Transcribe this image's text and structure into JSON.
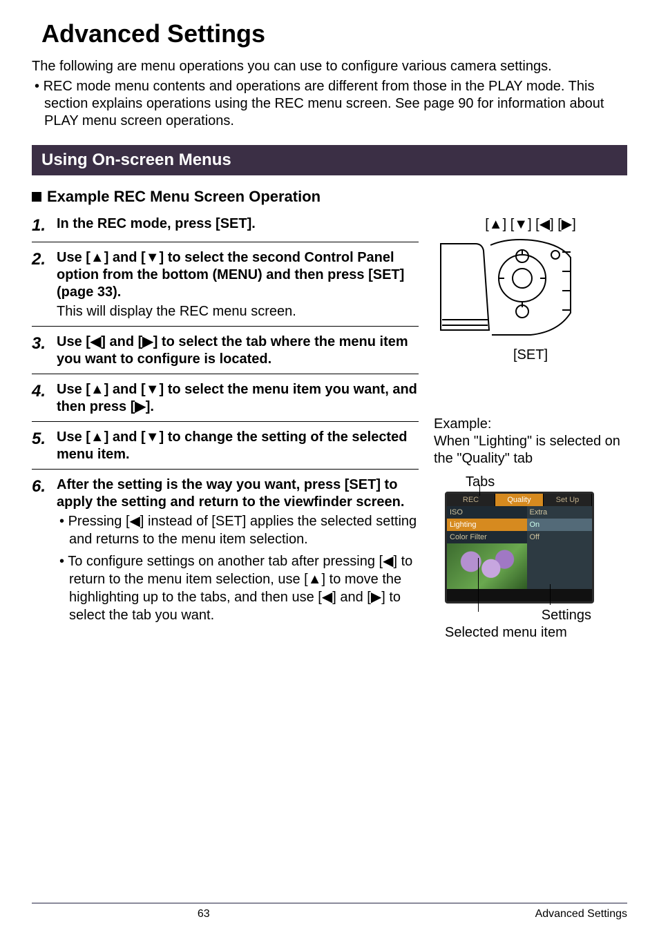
{
  "glyphs": {
    "up": "▲",
    "down": "▼",
    "left": "◀",
    "right": "▶",
    "bullet": "•"
  },
  "title": "Advanced Settings",
  "intro": "The following are menu operations you can use to configure various camera settings.",
  "note": "REC mode menu contents and operations are different from those in the PLAY mode. This section explains operations using the REC menu screen. See page 90 for information about PLAY menu screen operations.",
  "section": "Using On-screen Menus",
  "subhead": "Example REC Menu Screen Operation",
  "steps": {
    "s1": {
      "num": "1.",
      "bold": "In the REC mode, press [SET]."
    },
    "s2": {
      "num": "2.",
      "bold_a": "Use [",
      "bold_b": "] and [",
      "bold_c": "] to select the second Control Panel option from the bottom (MENU) and then press [SET] (page 33).",
      "body": "This will display the REC menu screen."
    },
    "s3": {
      "num": "3.",
      "bold_a": "Use [",
      "bold_b": "] and [",
      "bold_c": "] to select the tab where the menu item you want to configure is located."
    },
    "s4": {
      "num": "4.",
      "bold_a": "Use [",
      "bold_b": "] and [",
      "bold_c": "] to select the menu item you want, and then press [",
      "bold_d": "]."
    },
    "s5": {
      "num": "5.",
      "bold_a": "Use [",
      "bold_b": "] and [",
      "bold_c": "] to change the setting of the selected menu item."
    },
    "s6": {
      "num": "6.",
      "bold": "After the setting is the way you want, press [SET] to apply the setting and return to the viewfinder screen.",
      "n1a": "Pressing [",
      "n1b": "] instead of [SET] applies the selected setting and returns to the menu item selection.",
      "n2a": "To configure settings on another tab after pressing [",
      "n2b": "] to return to the menu item selection, use [",
      "n2c": "] to move the highlighting up to the tabs, and then use [",
      "n2d": "] and [",
      "n2e": "] to select the tab you want."
    }
  },
  "right": {
    "keys_a": "[",
    "keys_b": "] [",
    "keys_c": "] [",
    "keys_d": "] [",
    "keys_e": "]",
    "set_label": "[SET]",
    "example_a": "Example:",
    "example_b": "When \"Lighting\" is selected on the \"Quality\" tab",
    "tabs_label": "Tabs",
    "screen": {
      "tabs": {
        "t0": "REC",
        "t1": "Quality",
        "t2": "Set Up"
      },
      "left": {
        "r0": "ISO",
        "r1": "Lighting",
        "r2": "Color Filter"
      },
      "right": {
        "r0": "Extra",
        "r1": "On",
        "r2": "Off"
      }
    },
    "settings_label": "Settings",
    "selected_label": "Selected menu item"
  },
  "footer": {
    "page": "63",
    "name": "Advanced Settings"
  }
}
